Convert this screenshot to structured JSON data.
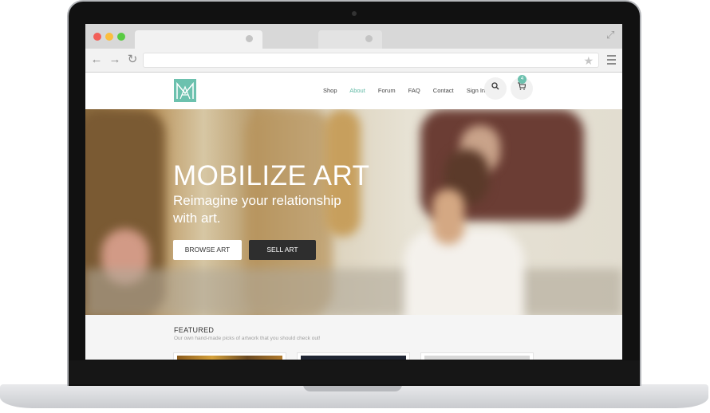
{
  "browser": {
    "tabs": [
      {
        "label": ""
      },
      {
        "label": ""
      }
    ],
    "address": "",
    "colors": {
      "close": "#f25f58",
      "minimize": "#fbbe3e",
      "maximize": "#58cb42"
    }
  },
  "site": {
    "nav": [
      "Shop",
      "About",
      "Forum",
      "FAQ",
      "Contact",
      "Sign In"
    ],
    "active_nav": "About",
    "cart_count": "4",
    "accent_color": "#6cc1ae"
  },
  "hero": {
    "title": "MOBILIZE ART",
    "subtitle": "Reimagine your relationship with art.",
    "browse_label": "BROWSE ART",
    "sell_label": "SELL ART"
  },
  "featured": {
    "title": "FEATURED",
    "subtitle": "Our own hand-made picks of artwork that you should check out!"
  }
}
